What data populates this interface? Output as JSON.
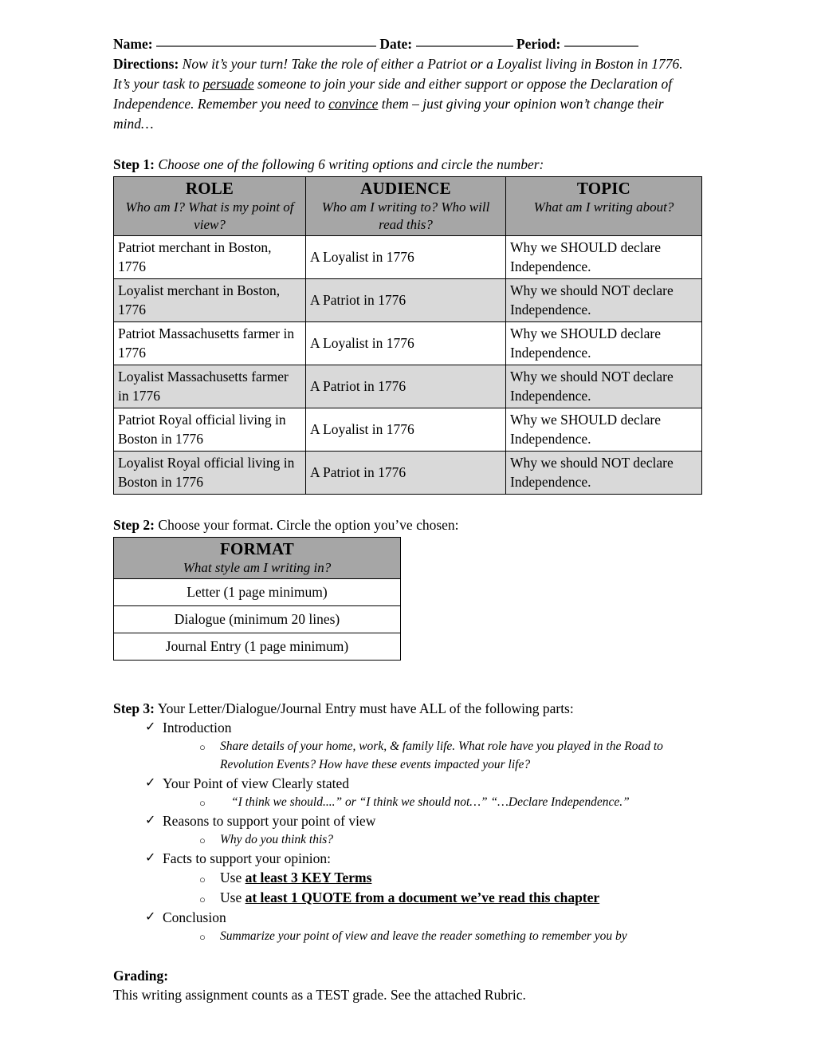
{
  "header": {
    "name_label": "Name:",
    "date_label": "Date:",
    "period_label": "Period:",
    "name_value": "",
    "date_value": "",
    "period_value": ""
  },
  "directions": {
    "label": "Directions:",
    "part1": " Now it’s your turn!  Take the role of either a Patriot or a Loyalist living in Boston in 1776.  It’s your task to ",
    "underline1": "persuade",
    "part2": " someone to join your side and either support or oppose the Declaration of Independence.  Remember you need to ",
    "underline2": "convince",
    "part3": " them – just giving your opinion won’t change their mind…"
  },
  "step1": {
    "num": "Step 1:",
    "text": " Choose one of the following 6 writing options and circle the number:",
    "table": {
      "columns": [
        {
          "title": "ROLE",
          "subtitle": "Who am I? What is my point of view?"
        },
        {
          "title": "AUDIENCE",
          "subtitle": "Who am I writing to? Who will read this?"
        },
        {
          "title": "TOPIC",
          "subtitle": "What am I writing about?"
        }
      ],
      "rows": [
        {
          "role": "Patriot merchant in Boston, 1776",
          "audience": "A Loyalist in 1776",
          "topic": "Why we SHOULD declare Independence.",
          "shaded": false
        },
        {
          "role": "Loyalist merchant in Boston, 1776",
          "audience": "A Patriot in 1776",
          "topic": "Why we should NOT declare Independence.",
          "shaded": true
        },
        {
          "role": "Patriot Massachusetts farmer in 1776",
          "audience": "A Loyalist in 1776",
          "topic": "Why we SHOULD declare Independence.",
          "shaded": false
        },
        {
          "role": "Loyalist Massachusetts farmer in 1776",
          "audience": "A Patriot in 1776",
          "topic": "Why we should NOT declare Independence.",
          "shaded": true
        },
        {
          "role": "Patriot Royal official living in Boston in 1776",
          "audience": "A Loyalist in 1776",
          "topic": "Why we SHOULD declare Independence.",
          "shaded": false
        },
        {
          "role": "Loyalist Royal official living in Boston in 1776",
          "audience": "A Patriot in 1776",
          "topic": "Why we should NOT declare Independence.",
          "shaded": true
        }
      ]
    }
  },
  "step2": {
    "num": "Step 2:",
    "text": " Choose your format. Circle the option you’ve chosen:",
    "table": {
      "header_title": "FORMAT",
      "header_subtitle": "What style am I writing in?",
      "options": [
        "Letter (1 page minimum)",
        "Dialogue (minimum 20 lines)",
        "Journal Entry (1 page minimum)"
      ]
    }
  },
  "step3": {
    "num": "Step 3:",
    "text": " Your Letter/Dialogue/Journal Entry must have ALL of the following parts:",
    "check_glyph": "✓",
    "circle_glyph": "○",
    "items": [
      {
        "label": "Introduction",
        "subs": [
          {
            "text": "Share details of your home, work, & family life. What role have you played in the Road to Revolution Events? How have these events impacted your life?",
            "style": "italic"
          }
        ]
      },
      {
        "label": "Your Point of view Clearly stated",
        "subs": [
          {
            "text": "“I think we should....” or “I think we should not…” “…Declare Independence.”",
            "style": "italic-indent"
          }
        ]
      },
      {
        "label": "Reasons to support your point of view",
        "subs": [
          {
            "text": "Why do you think this?",
            "style": "italic"
          }
        ]
      },
      {
        "label": "Facts to support your opinion:",
        "subs": [
          {
            "prefix": "Use ",
            "bold_underline": "at least 3 KEY Terms",
            "style": "emphasis"
          },
          {
            "prefix": "Use ",
            "bold_underline": "at least 1 QUOTE from a document we’ve read this chapter",
            "style": "emphasis"
          }
        ]
      },
      {
        "label": "Conclusion",
        "subs": [
          {
            "text": "Summarize your point of view and leave the reader something to remember you by",
            "style": "italic"
          }
        ]
      }
    ]
  },
  "grading": {
    "heading": "Grading:",
    "body": "This writing assignment counts as a TEST grade. See the attached Rubric."
  },
  "colors": {
    "header_shade": "#a6a6a6",
    "row_shade": "#d9d9d9",
    "border": "#000000",
    "blank_rule": "#6a6a6a"
  }
}
